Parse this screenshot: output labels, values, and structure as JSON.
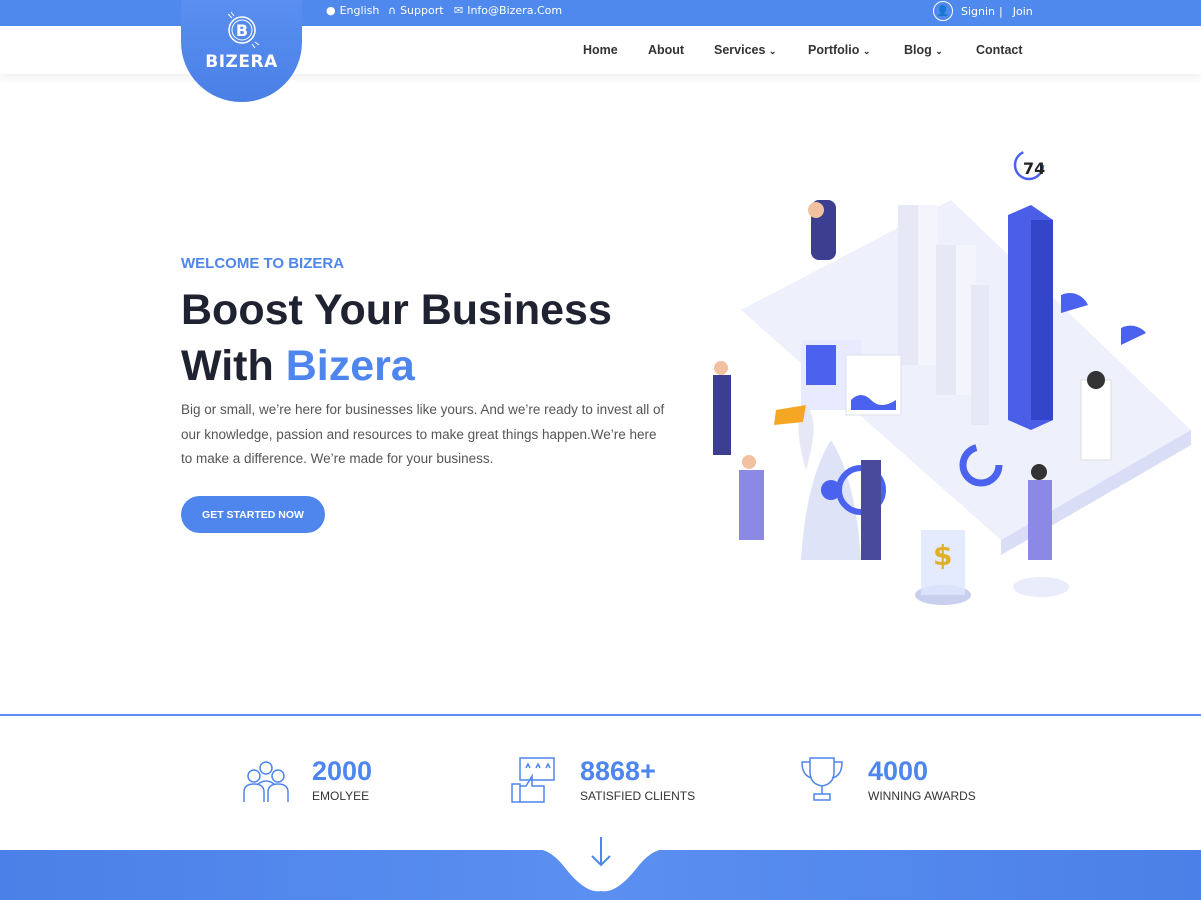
{
  "topbar": {
    "language": "English",
    "support": "Support",
    "email": "Info@Bizera.Com",
    "signin": "Signin",
    "separator": "|",
    "join": "Join"
  },
  "logo": {
    "name": "BIZERA"
  },
  "nav": {
    "items": [
      {
        "label": "Home"
      },
      {
        "label": "About"
      },
      {
        "label": "Services",
        "dropdown": true
      },
      {
        "label": "Portfolio",
        "dropdown": true
      },
      {
        "label": "Blog",
        "dropdown": true
      },
      {
        "label": "Contact"
      }
    ]
  },
  "hero": {
    "welcome": "WELCOME TO BIZERA",
    "title_line1": "Boost Your Business",
    "title_line2_prefix": "With ",
    "title_line2_accent": "Bizera",
    "description": "Big or small, we’re here for businesses like yours. And we’re ready to invest all of our knowledge, passion and resources to make great things happen.We’re here to make a difference. We’re made for your business.",
    "cta": "GET STARTED NOW",
    "illustration_badge": "74"
  },
  "stats": [
    {
      "icon": "team-icon",
      "value": "2000",
      "label": "EMOLYEE"
    },
    {
      "icon": "thumbs-up-rating-icon",
      "value": "8868+",
      "label": "SATISFIED CLIENTS"
    },
    {
      "icon": "trophy-icon",
      "value": "4000",
      "label": "WINNING AWARDS"
    }
  ],
  "colors": {
    "accent": "#4f86ee",
    "dark": "#1f2230"
  }
}
